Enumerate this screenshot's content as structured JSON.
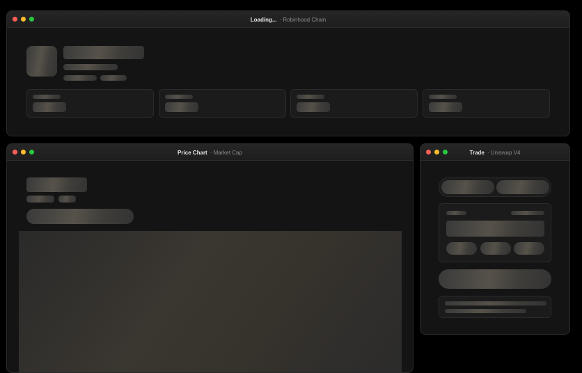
{
  "header_window": {
    "title": "Loading...",
    "subtitle": "· Robinhood Chain"
  },
  "chart_window": {
    "title": "Price Chart",
    "subtitle": "· Market Cap"
  },
  "trade_window": {
    "title": "Trade",
    "subtitle": "· Uniswap V4"
  },
  "colors": {
    "close": "#ff5f57",
    "minimize": "#febc2e",
    "zoom": "#28c840",
    "background": "#000000",
    "window": "#141414"
  }
}
